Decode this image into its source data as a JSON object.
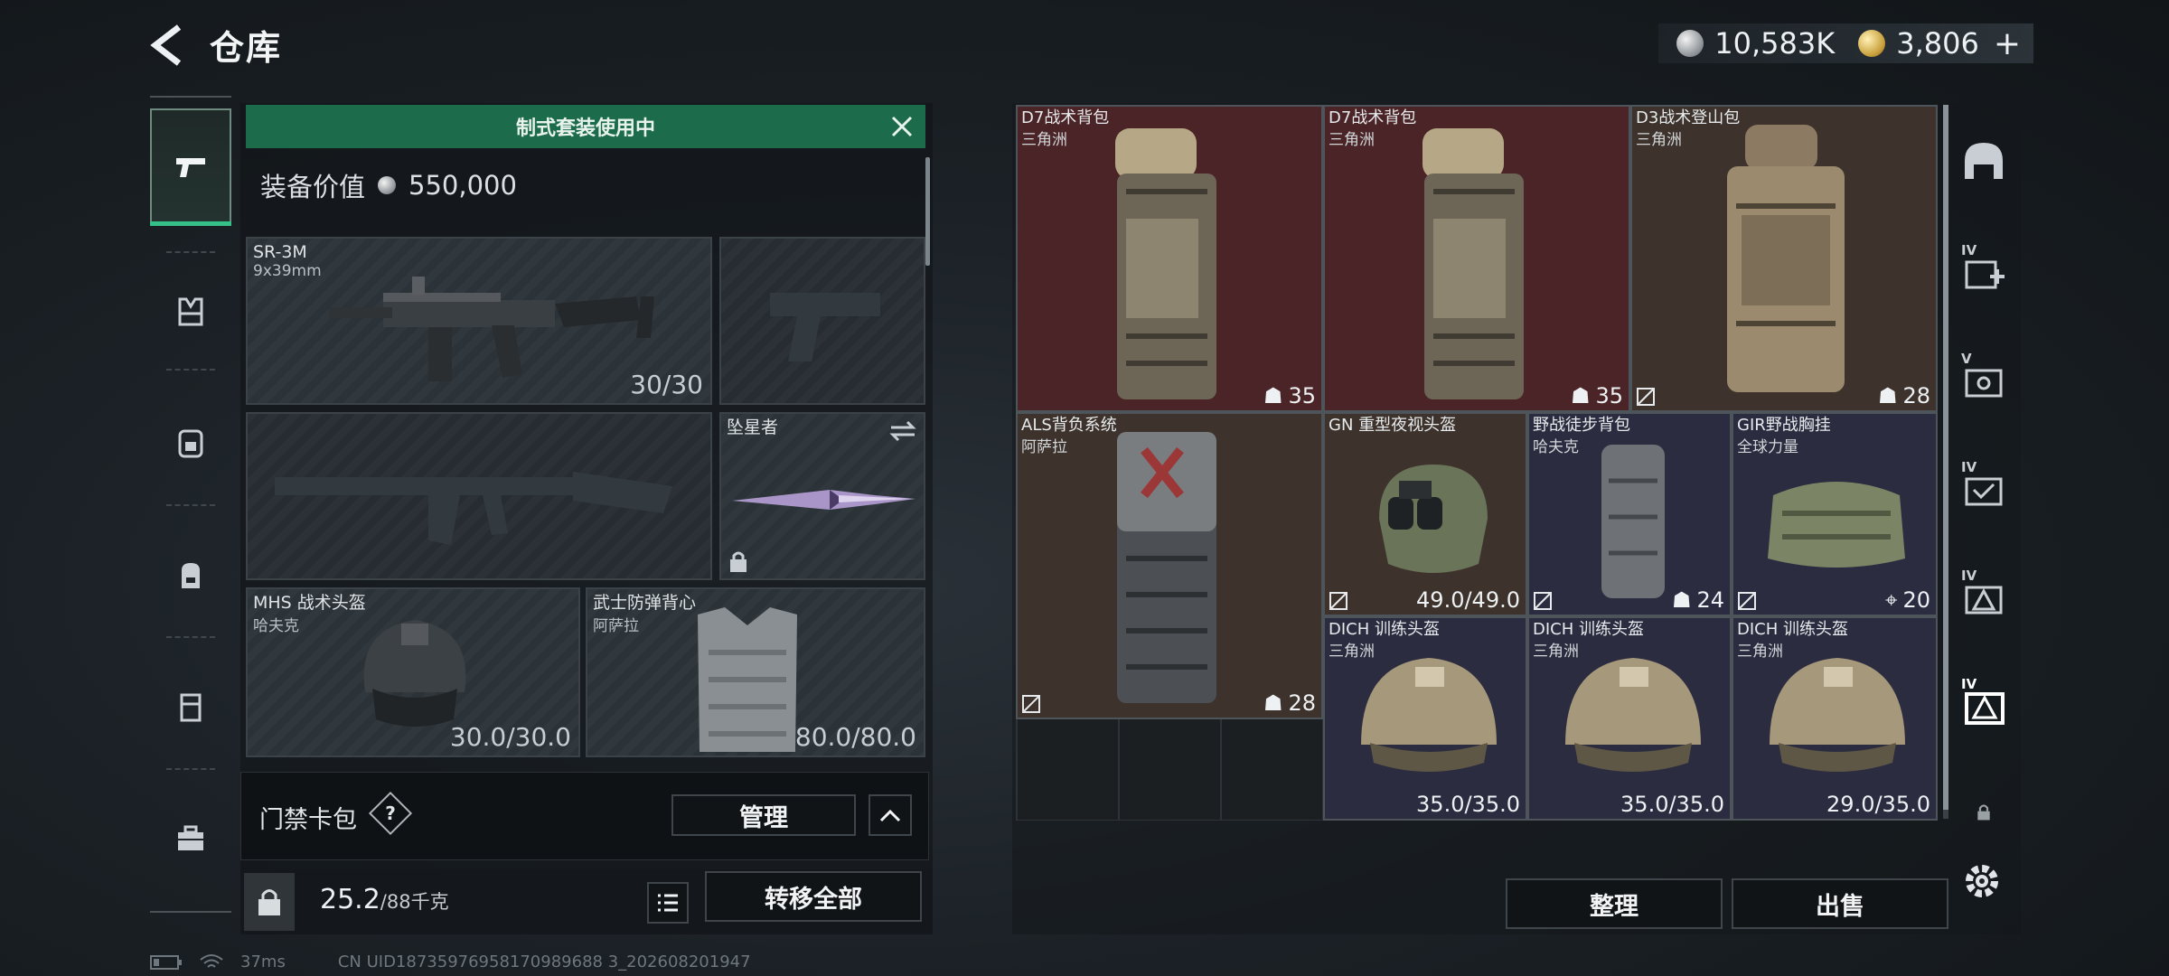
{
  "header": {
    "title": "仓库"
  },
  "currency": [
    {
      "icon": "silver-coin-icon",
      "value": "10,583K"
    },
    {
      "icon": "gold-coin-icon",
      "value": "3,806"
    }
  ],
  "loadout": {
    "banner": "制式套装使用中",
    "equip_value_label": "装备价值",
    "equip_value": "550,000",
    "slots": {
      "primary": {
        "name": "SR-3M",
        "sub": "9x39mm",
        "durability": "30/30"
      },
      "melee": {
        "name": "坠星者"
      },
      "helmet": {
        "name": "MHS 战术头盔",
        "brand": "哈夫克",
        "durability": "30.0/30.0"
      },
      "armor": {
        "name": "武士防弹背心",
        "brand": "阿萨拉",
        "durability": "80.0/80.0"
      }
    },
    "card_bag": {
      "label": "门禁卡包",
      "help": "?",
      "manage": "管理"
    },
    "capacity": {
      "current": "25.2",
      "max": "/88千克"
    },
    "transfer_all": "转移全部"
  },
  "stash": {
    "items": [
      {
        "name": "D7战术背包",
        "brand": "三角洲",
        "value": "35",
        "rarity": "red"
      },
      {
        "name": "D7战术背包",
        "brand": "三角洲",
        "value": "35",
        "rarity": "red"
      },
      {
        "name": "D3战术登山包",
        "brand": "三角洲",
        "value": "28",
        "rarity": "brown"
      },
      {
        "name": "ALS背负系统",
        "brand": "阿萨拉",
        "value": "28",
        "rarity": "brown"
      },
      {
        "name": "GN 重型夜视头盔",
        "brand": "",
        "value": "49.0/49.0",
        "rarity": "brown"
      },
      {
        "name": "野战徒步背包",
        "brand": "哈夫克",
        "value": "24",
        "rarity": "purple"
      },
      {
        "name": "GIR野战胸挂",
        "brand": "全球力量",
        "value": "20",
        "rarity": "purple"
      },
      {
        "name": "DICH 训练头盔",
        "brand": "三角洲",
        "value": "35.0/35.0",
        "rarity": "purple"
      },
      {
        "name": "DICH 训练头盔",
        "brand": "三角洲",
        "value": "35.0/35.0",
        "rarity": "purple"
      },
      {
        "name": "DICH 训练头盔",
        "brand": "三角洲",
        "value": "29.0/35.0",
        "rarity": "purple"
      }
    ],
    "sort": "整理",
    "sell": "出售"
  },
  "right_rail": [
    {
      "icon": "stash-home-icon",
      "tag": ""
    },
    {
      "icon": "add-storage-icon",
      "tag": "IV"
    },
    {
      "icon": "storage-v-icon",
      "tag": "V"
    },
    {
      "icon": "storage-iv-icon",
      "tag": "IV"
    },
    {
      "icon": "storage-iv-b-icon",
      "tag": "IV"
    },
    {
      "icon": "storage-iv-active-icon",
      "tag": "IV"
    }
  ],
  "status": {
    "ping": "37ms",
    "uid": "CN UID18735976958170989688 3_202608201947"
  },
  "colors": {
    "accent": "#1c6b4a",
    "rarity_red": "#4b2427",
    "rarity_brown": "#3d332c",
    "rarity_purple": "#2c2c40"
  }
}
